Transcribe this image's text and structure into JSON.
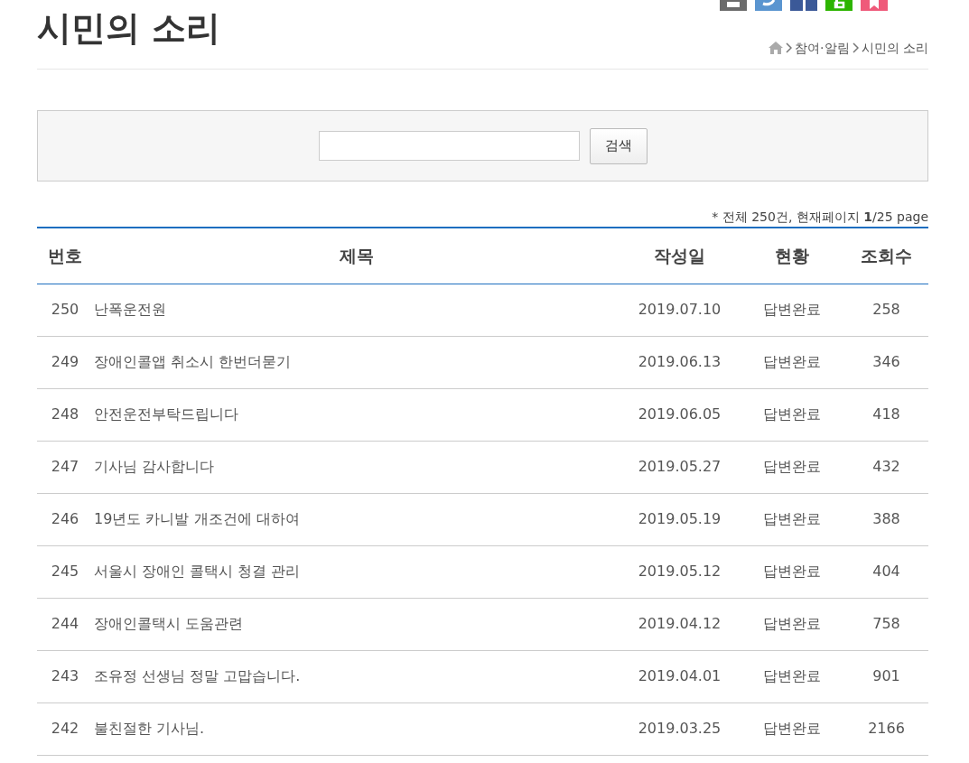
{
  "page_title": "시민의 소리",
  "breadcrumb": [
    "참여·알림",
    "시민의 소리"
  ],
  "share_icons": [
    {
      "kind": "print",
      "color": "#6b6b6b"
    },
    {
      "kind": "twitter",
      "color": "#5a95d0"
    },
    {
      "kind": "facebook",
      "color": "#3b5998"
    },
    {
      "kind": "blog",
      "color": "#2db400"
    },
    {
      "kind": "bookmark",
      "color": "#ef5a7a"
    }
  ],
  "search": {
    "button": "검색"
  },
  "summary": "* 전체 250건, 현재페이지 **1**/25 page",
  "table": {
    "columns": [
      "번호",
      "제목",
      "작성일",
      "현황",
      "조회수"
    ],
    "rows": [
      [
        "250",
        "난폭운전원",
        "2019.07.10",
        "답변완료",
        "258"
      ],
      [
        "249",
        "장애인콜앱 취소시 한번더묻기",
        "2019.06.13",
        "답변완료",
        "346"
      ],
      [
        "248",
        "안전운전부탁드립니다",
        "2019.06.05",
        "답변완료",
        "418"
      ],
      [
        "247",
        "기사님 감사합니다",
        "2019.05.27",
        "답변완료",
        "432"
      ],
      [
        "246",
        "19년도 카니발 개조건에 대하여",
        "2019.05.19",
        "답변완료",
        "388"
      ],
      [
        "245",
        "서울시 장애인 콜택시 청결 관리",
        "2019.05.12",
        "답변완료",
        "404"
      ],
      [
        "244",
        "장애인콜택시 도움관련",
        "2019.04.12",
        "답변완료",
        "758"
      ],
      [
        "243",
        "조유정 선생님 정말 고맙습니다.",
        "2019.04.01",
        "답변완료",
        "901"
      ],
      [
        "242",
        "불친절한 기사님.",
        "2019.03.25",
        "답변완료",
        "2166"
      ]
    ]
  }
}
